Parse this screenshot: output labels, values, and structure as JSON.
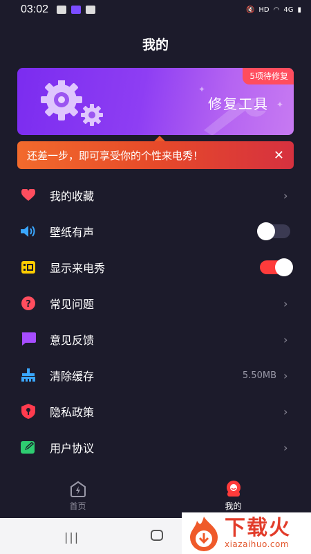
{
  "status": {
    "time": "03:02",
    "hd": "HD",
    "network": "4G"
  },
  "header": {
    "title": "我的"
  },
  "banner": {
    "badge": "5项待修复",
    "title": "修复工具"
  },
  "notice": {
    "text": "还差一步，即可享受你的个性来电秀！",
    "close": "✕"
  },
  "menu": [
    {
      "label": "我的收藏",
      "icon": "heart-icon",
      "color": "#ff4d5e"
    },
    {
      "label": "壁纸有声",
      "icon": "speaker-icon",
      "color": "#3aa7ff",
      "toggle": "off"
    },
    {
      "label": "显示来电秀",
      "icon": "film-icon",
      "color": "#ffcc00",
      "toggle": "on"
    },
    {
      "label": "常见问题",
      "icon": "question-icon",
      "color": "#ff4d5e"
    },
    {
      "label": "意见反馈",
      "icon": "feedback-icon",
      "color": "#a64dff"
    },
    {
      "label": "清除缓存",
      "icon": "broom-icon",
      "color": "#3aa7ff",
      "value": "5.50MB"
    },
    {
      "label": "隐私政策",
      "icon": "shield-icon",
      "color": "#ff3b4e"
    },
    {
      "label": "用户协议",
      "icon": "edit-icon",
      "color": "#2ecc71"
    }
  ],
  "nav": {
    "home": "首页",
    "mine": "我的"
  },
  "watermark": {
    "name": "下载火",
    "domain": "xiazaihuo.com"
  }
}
